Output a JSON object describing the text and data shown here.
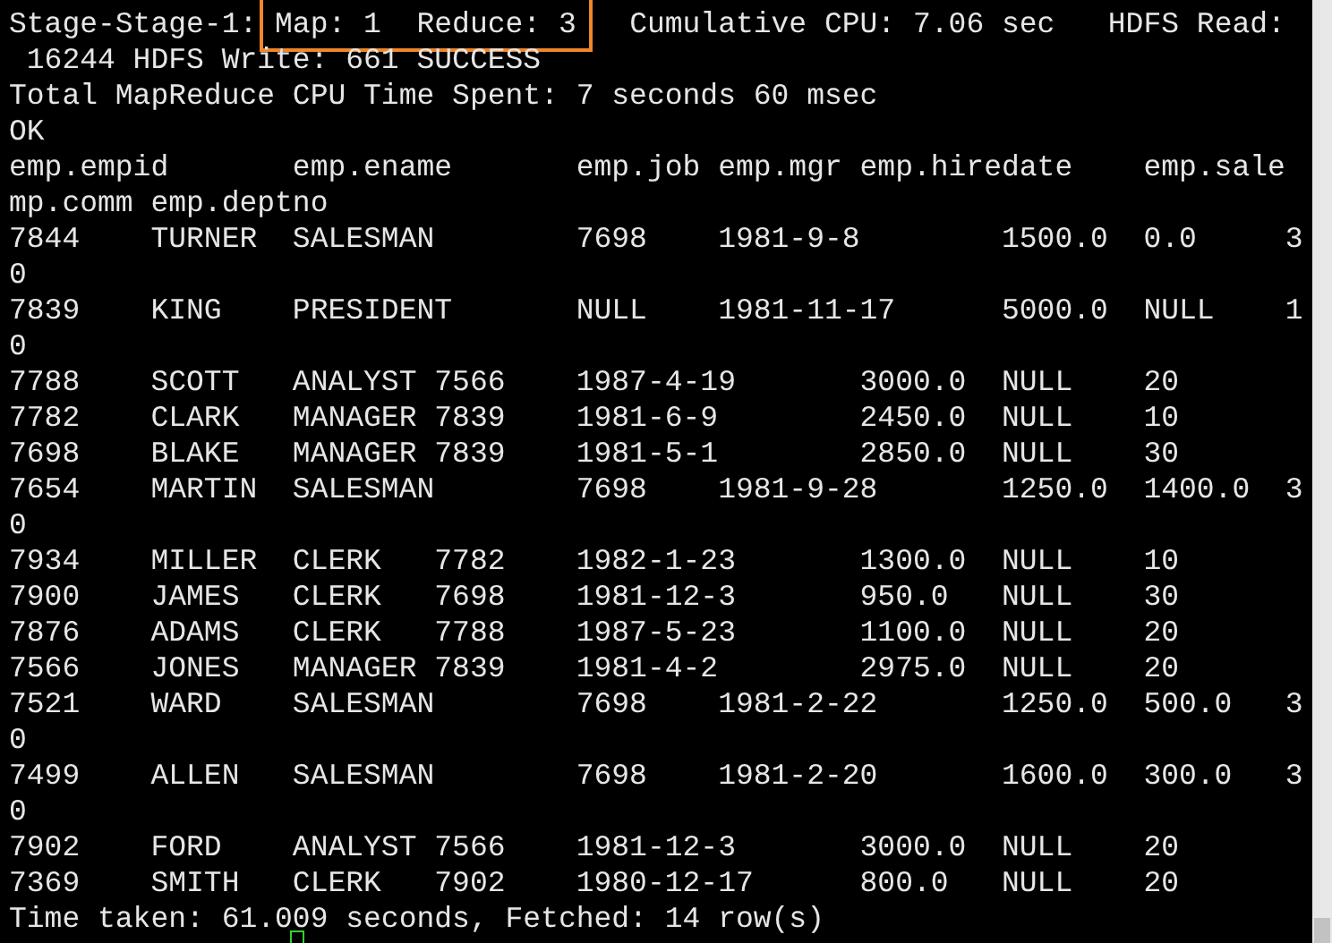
{
  "terminal": {
    "lines": [
      {
        "segments": [
          {
            "text": "Stage-Stage-1: ",
            "highlighted": false
          },
          {
            "text": "Map: 1  Reduce: 3",
            "highlighted": true
          },
          {
            "text": "   Cumulative CPU: 7.06 sec   HDFS Read:",
            "highlighted": false
          }
        ]
      },
      {
        "text": " 16244 HDFS Write: 661 SUCCESS"
      },
      {
        "text": "Total MapReduce CPU Time Spent: 7 seconds 60 msec"
      },
      {
        "text": "OK"
      },
      {
        "text": "emp.empid       emp.ename       emp.job emp.mgr emp.hiredate    emp.sale"
      },
      {
        "text": "mp.comm emp.deptno"
      },
      {
        "text": "7844    TURNER  SALESMAN        7698    1981-9-8        1500.0  0.0     3"
      },
      {
        "text": "0"
      },
      {
        "text": "7839    KING    PRESIDENT       NULL    1981-11-17      5000.0  NULL    1"
      },
      {
        "text": "0"
      },
      {
        "text": "7788    SCOTT   ANALYST 7566    1987-4-19       3000.0  NULL    20"
      },
      {
        "text": "7782    CLARK   MANAGER 7839    1981-6-9        2450.0  NULL    10"
      },
      {
        "text": "7698    BLAKE   MANAGER 7839    1981-5-1        2850.0  NULL    30"
      },
      {
        "text": "7654    MARTIN  SALESMAN        7698    1981-9-28       1250.0  1400.0  3"
      },
      {
        "text": "0"
      },
      {
        "text": "7934    MILLER  CLERK   7782    1982-1-23       1300.0  NULL    10"
      },
      {
        "text": "7900    JAMES   CLERK   7698    1981-12-3       950.0   NULL    30"
      },
      {
        "text": "7876    ADAMS   CLERK   7788    1987-5-23       1100.0  NULL    20"
      },
      {
        "text": "7566    JONES   MANAGER 7839    1981-4-2        2975.0  NULL    20"
      },
      {
        "text": "7521    WARD    SALESMAN        7698    1981-2-22       1250.0  500.0   3"
      },
      {
        "text": "0"
      },
      {
        "text": "7499    ALLEN   SALESMAN        7698    1981-2-20       1600.0  300.0   3"
      },
      {
        "text": "0"
      },
      {
        "text": "7902    FORD    ANALYST 7566    1981-12-3       3000.0  NULL    20"
      },
      {
        "text": "7369    SMITH   CLERK   7902    1980-12-17      800.0   NULL    20"
      },
      {
        "text": "Time taken: 61.009 seconds, Fetched: 14 row(s)"
      }
    ]
  }
}
